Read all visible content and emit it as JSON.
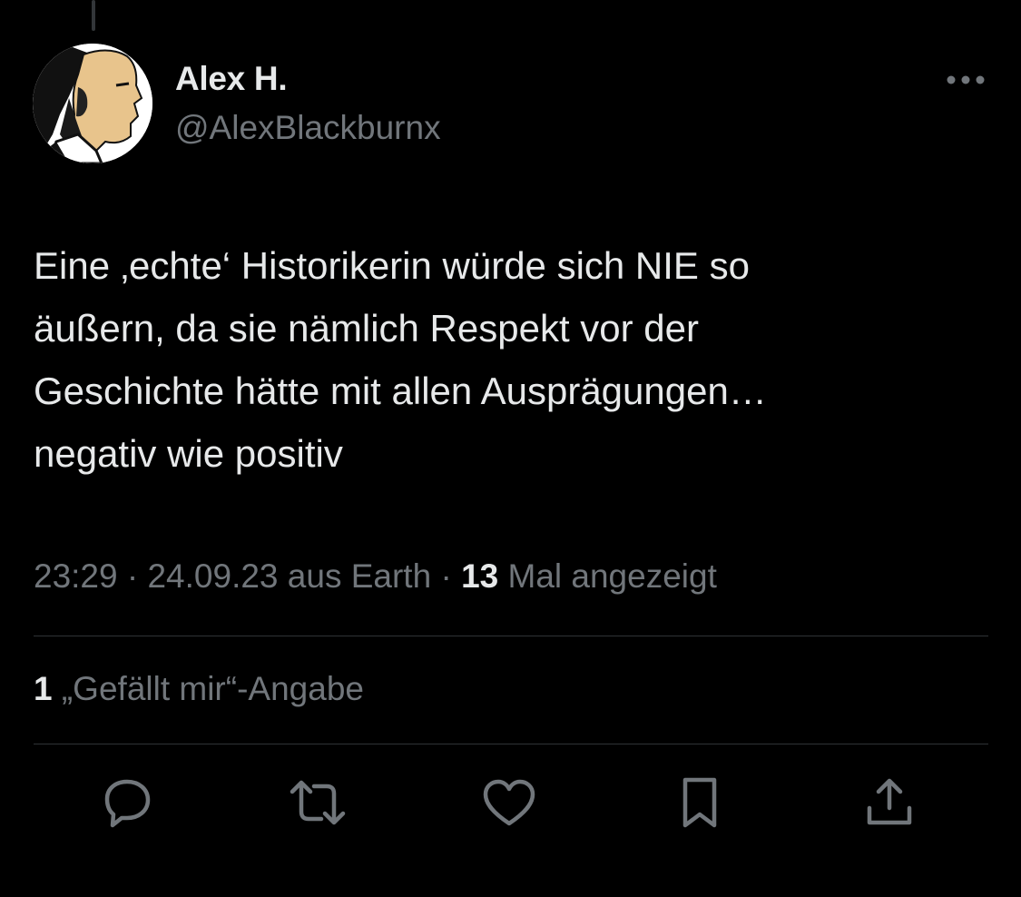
{
  "author": {
    "display_name": "Alex H.",
    "handle": "@AlexBlackburnx"
  },
  "tweet": {
    "lines": [
      "Eine ‚echte‘ Historikerin würde sich NIE so",
      "äußern, da sie nämlich Respekt vor der",
      "Geschichte hätte mit allen Ausprägungen…",
      "negativ wie positiv"
    ]
  },
  "meta": {
    "time": "23:29",
    "separator": " · ",
    "date": "24.09.23",
    "source": "aus Earth",
    "views_count": "13",
    "views_label": "Mal angezeigt"
  },
  "engagement": {
    "likes_count": "1",
    "likes_label": "„Gefällt mir“-Angabe"
  },
  "icons": {
    "more": "more-horizontal-icon",
    "reply": "reply-bubble-icon",
    "repost": "repost-icon",
    "like": "heart-icon",
    "bookmark": "bookmark-icon",
    "share": "share-upload-icon"
  },
  "colors": {
    "background": "#000000",
    "primary_text": "#e7e9ea",
    "secondary_text": "#71767b",
    "divider": "#2f3336"
  }
}
